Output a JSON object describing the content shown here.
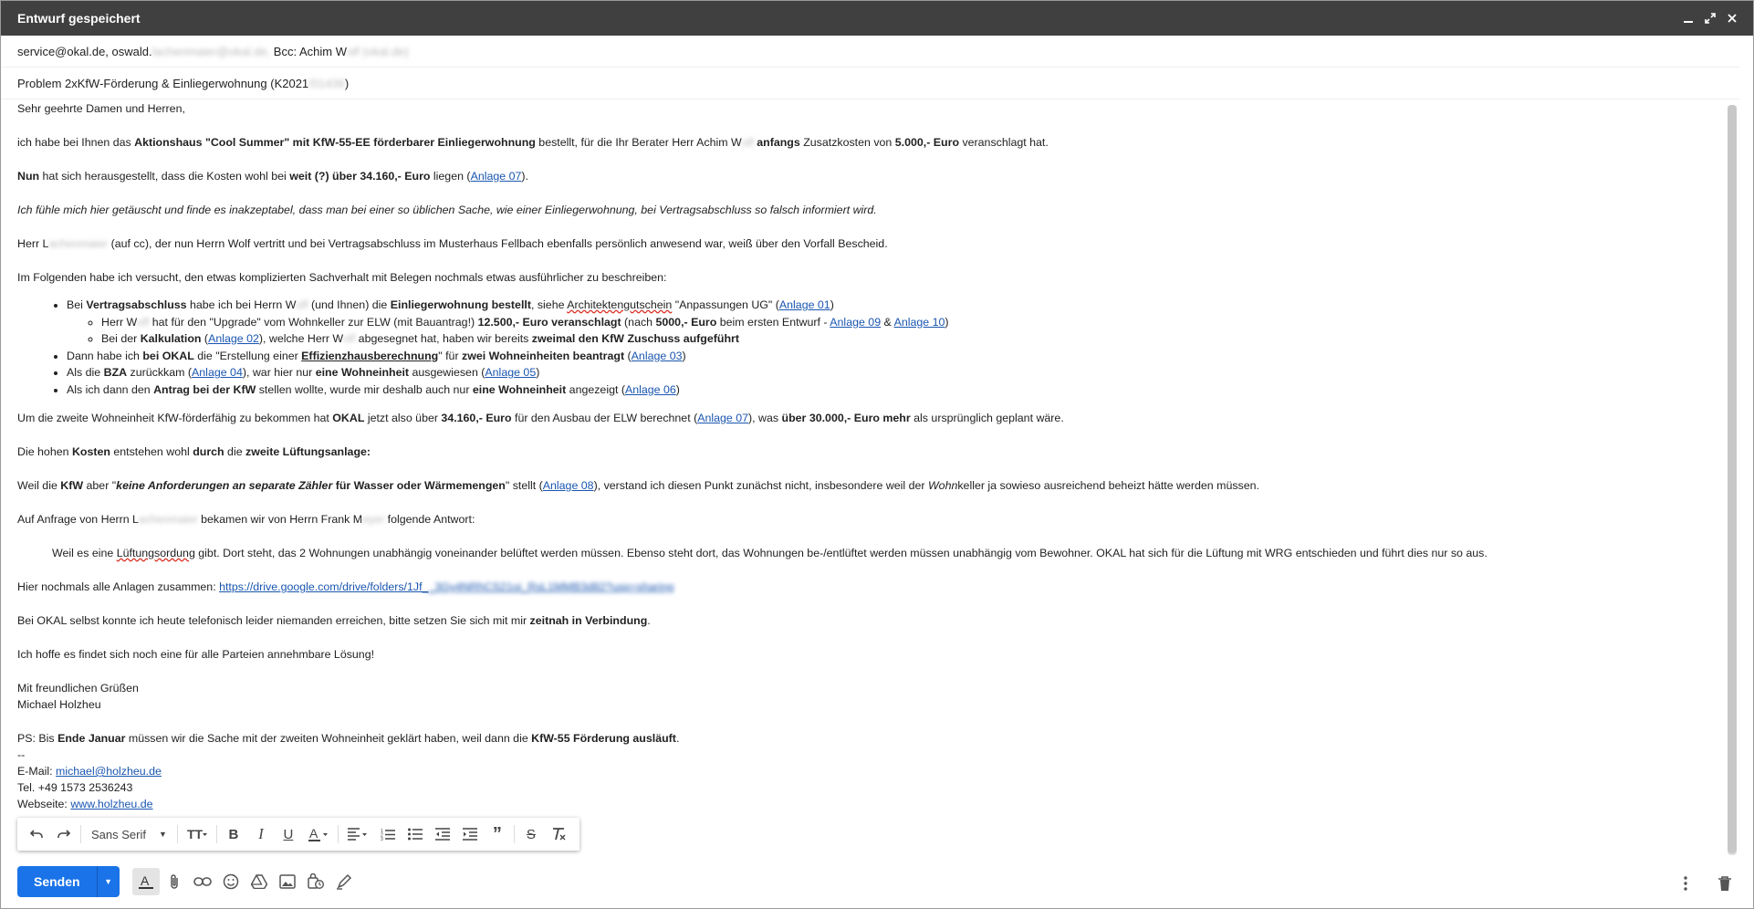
{
  "window": {
    "title": "Entwurf gespeichert"
  },
  "recipients": {
    "to_1": "service@okal.de, oswald.",
    "to_1_blur": "lachenmaier@okal.de,",
    "bcc_label": "Bcc: Achim W",
    "bcc_blur": "olf (okal.de)"
  },
  "subject": {
    "prefix": "Problem 2xKfW-Förderung & Einliegerwohnung (K2021",
    "blur": "/01436",
    "suffix": ")"
  },
  "body": {
    "greeting": "Sehr geehrte Damen und Herren,",
    "p1": {
      "a": "ich habe bei Ihnen das ",
      "b1": "Aktionshaus \"Cool Summer\" mit KfW-55-EE förderbarer Einliegerwohnung",
      "c": " bestellt, für die Ihr Berater Herr Achim W",
      "blur": "olf",
      "b2": " anfangs",
      "d": " Zusatzkosten von ",
      "b3": "5.000,- Euro",
      "e": " veranschlagt hat."
    },
    "p2": {
      "b1": "Nun",
      "a": " hat sich herausgestellt, dass die Kosten wohl bei ",
      "b2": "weit (?) über 34.160,- Euro",
      "c": " liegen (",
      "link": "Anlage 07",
      "d": ")."
    },
    "p3": "Ich fühle mich hier getäuscht und finde es inakzeptabel, dass man bei einer so üblichen Sache, wie einer Einliegerwohnung, bei Vertragsabschluss so falsch informiert wird.",
    "p4": {
      "a": "Herr L",
      "blur": "achenmaier",
      "b": " (auf cc), der nun Herrn Wolf vertritt und bei Vertragsabschluss im Musterhaus Fellbach ebenfalls persönlich anwesend war, weiß über den Vorfall Bescheid."
    },
    "p5": "Im Folgenden habe ich versucht, den etwas komplizierten Sachverhalt mit Belegen nochmals etwas ausführlicher zu beschreiben:",
    "li1": {
      "a": "Bei ",
      "b1": "Vertragsabschluss",
      "c": " habe ich bei Herrn W",
      "blur": "olf",
      "d": " (und Ihnen) die ",
      "b2": "Einliegerwohnung bestellt",
      "e": ", siehe ",
      "spell": "Architektengutschein",
      "f": " \"Anpassungen UG\" (",
      "link": "Anlage 01",
      "g": ")"
    },
    "li1a": {
      "a": "Herr W",
      "blur": "olf",
      "b": " hat für den \"Upgrade\" vom Wohnkeller zur ELW (mit Bauantrag!) ",
      "b1": "12.500,- Euro veranschlagt",
      "c": " (nach ",
      "b2": "5000,- Euro",
      "d": " beim ersten Entwurf - ",
      "link1": "Anlage 09",
      "e": " & ",
      "link2": "Anlage 10",
      "f": ")"
    },
    "li1b": {
      "a": "Bei der ",
      "b1": "Kalkulation",
      "c": " (",
      "link": "Anlage 02",
      "d": "), welche Herr W",
      "blur": "olf",
      "e": " abgesegnet hat, haben wir bereits ",
      "b2": "zweimal den KfW Zuschuss aufgeführt"
    },
    "li2": {
      "a": "Dann habe ich ",
      "b1": "bei OKAL",
      "c": " die \"Erstellung einer ",
      "bu": "Effizienzhausberechnung",
      "d": "\" für ",
      "b2": "zwei Wohneinheiten beantragt",
      "e": " (",
      "link": "Anlage 03",
      "f": ")"
    },
    "li3": {
      "a": "Als die ",
      "b1": "BZA",
      "c": " zurückkam (",
      "link1": "Anlage 04",
      "d": "), war hier nur ",
      "b2": "eine Wohneinheit",
      "e": " ausgewiesen (",
      "link2": "Anlage 05",
      "f": ")"
    },
    "li4": {
      "a": "Als ich dann den ",
      "b1": "Antrag bei der KfW",
      "c": " stellen wollte, wurde mir deshalb auch nur ",
      "b2": "eine Wohneinheit",
      "d": " angezeigt (",
      "link": "Anlage 06",
      "e": ")"
    },
    "p6": {
      "a": "Um die zweite Wohneinheit KfW-förderfähig zu bekommen hat ",
      "b1": "OKAL",
      "c": " jetzt also über ",
      "b2": "34.160,- Euro",
      "d": " für den Ausbau der ELW berechnet (",
      "link": "Anlage 07",
      "e": "), was ",
      "b3": "über 30.000,- Euro mehr",
      "f": " als ursprünglich geplant wäre."
    },
    "p7": {
      "a": "Die hohen ",
      "b1": "Kosten",
      "c": " entstehen wohl ",
      "b2": "durch",
      "d": " die ",
      "b3": "zweite Lüftungsanlage:"
    },
    "p8": {
      "a": "Weil die ",
      "b1": "KfW",
      "c": " aber \"",
      "bi": "keine Anforderungen an separate Zähler",
      "b2": " für Wasser oder Wärmemengen",
      "d": "\" stellt (",
      "link": "Anlage 08",
      "e": "), verstand ich diesen Punkt zunächst nicht, insbesondere weil der ",
      "i": "Wohn",
      "f": "keller ja sowieso ausreichend beheizt hätte werden müssen."
    },
    "p9": {
      "a": "Auf Anfrage von Herrn L",
      "blur1": "achenmaier",
      "b": " bekamen wir von Herrn Frank M",
      "blur2": "eyer",
      "c": " folgende Antwort:"
    },
    "quote": {
      "a": "Weil es eine ",
      "spell": "Lüftungsordung",
      "b": " gibt. Dort steht, das 2 Wohnungen unabhängig voneinander belüftet werden müssen. Ebenso steht dort, das Wohnungen be-/entlüftet werden müssen unabhängig vom Bewohner. OKAL hat sich für die Lüftung mit WRG entschieden und führt dies nur so aus."
    },
    "p10": {
      "a": "Hier nochmals alle Anlagen zusammen: ",
      "link": "https://drive.google.com/drive/folders/1Jf_",
      "blur": "_3Gy4NRhCS21oi_RsL1MMB3d82?usp=sharing"
    },
    "p11": {
      "a": "Bei OKAL selbst konnte ich heute telefonisch leider niemanden erreichen, bitte setzen Sie sich mit mir ",
      "b1": "zeitnah in Verbindung",
      "c": "."
    },
    "p12": "Ich hoffe es findet sich noch eine für alle Parteien annehmbare Lösung!",
    "closing": "Mit freundlichen Grüßen",
    "name": "Michael Holzheu",
    "ps": {
      "a": "PS: Bis ",
      "b1": "Ende Januar",
      "c": " müssen wir die Sache mit der zweiten Wohneinheit geklärt haben, weil dann die ",
      "b2": "KfW-55 Förderung ausläuft",
      "d": "."
    },
    "sigdash": "--",
    "email_label": "E-Mail: ",
    "email": "michael@holzheu.de",
    "tel": "Tel. +49 1573 2536243",
    "web_label": "Webseite: ",
    "web": "www.holzheu.de"
  },
  "format_toolbar": {
    "font": "Sans Serif"
  },
  "actions": {
    "send_label": "Senden"
  },
  "icons": [
    "minimize-icon",
    "restore-icon",
    "close-icon",
    "undo-icon",
    "redo-icon",
    "font-size-icon",
    "bold-icon",
    "italic-icon",
    "underline-icon",
    "text-color-icon",
    "align-icon",
    "numbered-list-icon",
    "bulleted-list-icon",
    "indent-less-icon",
    "indent-more-icon",
    "quote-icon",
    "strikethrough-icon",
    "remove-formatting-icon",
    "formatting-options-icon",
    "attach-icon",
    "link-icon",
    "emoji-icon",
    "drive-icon",
    "photo-icon",
    "confidential-icon",
    "signature-icon",
    "more-options-icon",
    "trash-icon"
  ]
}
